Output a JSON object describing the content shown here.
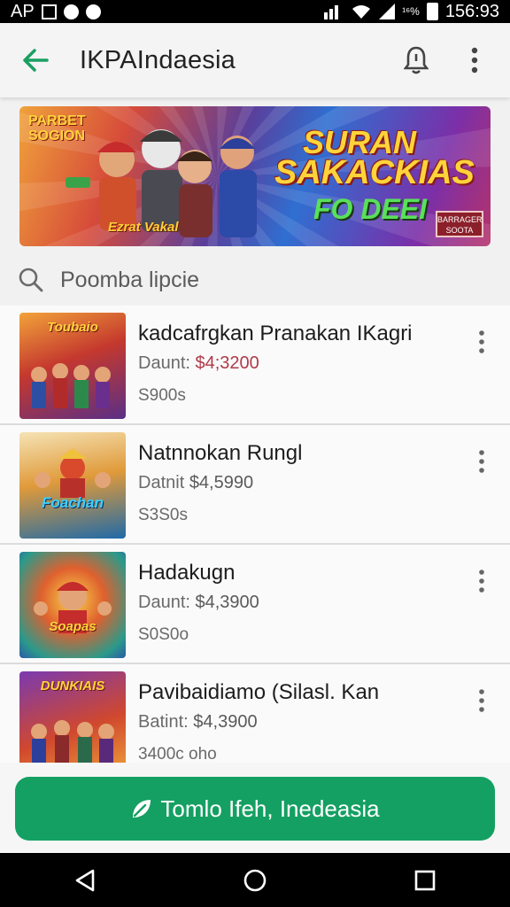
{
  "status_bar": {
    "left_text": "AP",
    "right_text": "156:93",
    "battery_text": "¹⁶%",
    "icons": [
      "gallery-icon",
      "notification-icon",
      "circle-icon",
      "signal-icon",
      "wifi-icon",
      "cell-icon",
      "battery-icon"
    ]
  },
  "app_bar": {
    "title": "IKPAIndaesia",
    "back_icon": "arrow-left-icon",
    "notification_icon": "bell-icon",
    "more_icon": "more-vert-icon"
  },
  "banner": {
    "tag": "PARBET SOGION",
    "caption": "Ezrat Vakal",
    "headline_1": "SURAN",
    "headline_2": "SAKACKIAS",
    "headline_3": "FO DEEI",
    "badge": "BARRAGER SOOTA",
    "colors": {
      "accent": "#ffd43a",
      "green": "#59e05a"
    }
  },
  "search": {
    "placeholder": "Poomba lipcie",
    "icon": "search-icon"
  },
  "list": {
    "items": [
      {
        "title": "kadcafrgkan Pranakan IKagri",
        "price_label": "Daunt:",
        "price": "$4;3200",
        "meta": "S900s",
        "thumb_label": "Toubaio"
      },
      {
        "title": "Natnnokan Rungl",
        "price_label": "Datnit",
        "price": "$4,5990",
        "meta": "S3S0s",
        "thumb_label": "Foachan"
      },
      {
        "title": "Hadakugn",
        "price_label": "Daunt:",
        "price": "$4,3900",
        "meta": "S0S0o",
        "thumb_label": "Soapas"
      },
      {
        "title": "Pavibaidiamo (Silasl. Kan",
        "price_label": "Batint:",
        "price": "$4,3900",
        "meta": "3400c oho",
        "thumb_label": "DUNKIAIS"
      }
    ]
  },
  "cta": {
    "label": "Tomlo Ifeh, Inedeasia",
    "icon": "leaf-icon",
    "color": "#14a062"
  },
  "nav_bar": {
    "back": "triangle-back-icon",
    "home": "circle-home-icon",
    "recents": "square-recents-icon"
  }
}
